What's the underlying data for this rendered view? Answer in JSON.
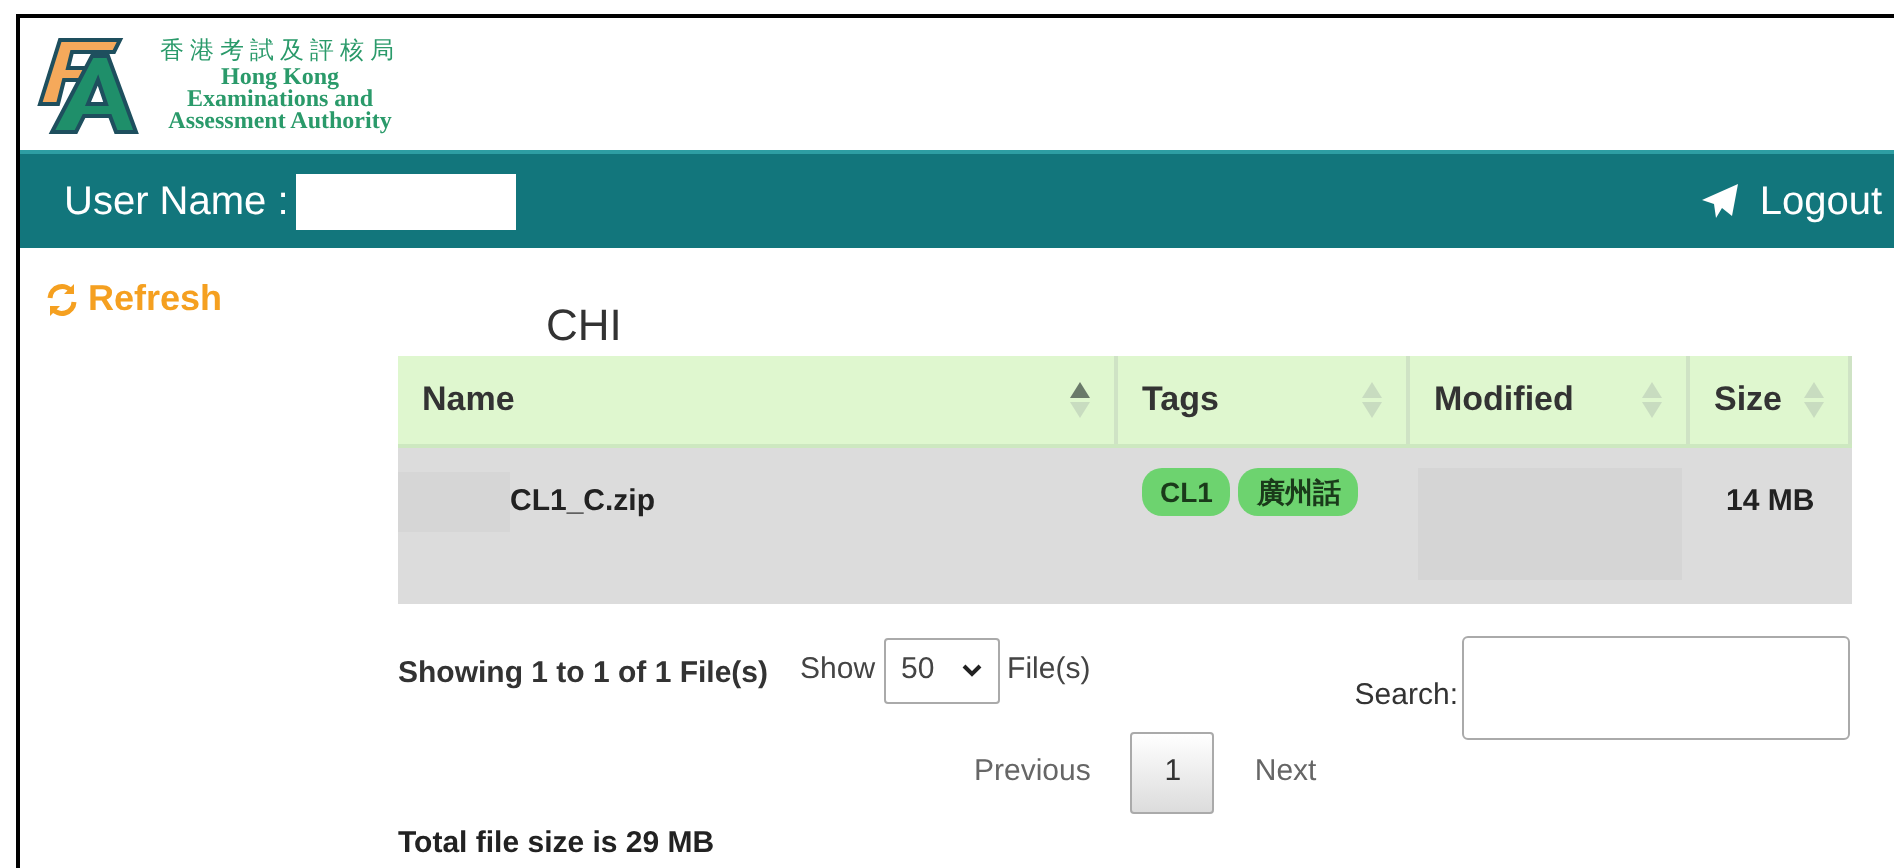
{
  "logo": {
    "chinese": "香港考試及評核局",
    "english_lines": [
      "Hong Kong",
      "Examinations and",
      "Assessment Authority"
    ]
  },
  "top_bar": {
    "user_label": "User Name :",
    "logout": "Logout"
  },
  "sidebar": {
    "refresh": "Refresh"
  },
  "folder_title": "CHI",
  "table": {
    "columns": [
      {
        "label": "Name",
        "sorted_ascending": true
      },
      {
        "label": "Tags",
        "sorted_ascending": false
      },
      {
        "label": "Modified",
        "sorted_ascending": false
      },
      {
        "label": "Size",
        "sorted_ascending": false
      }
    ],
    "rows": [
      {
        "name": "CL1_C.zip",
        "tags": [
          "CL1",
          "廣州話"
        ],
        "size": "14 MB",
        "selected": true
      }
    ]
  },
  "info": "Showing 1 to 1 of 1 File(s)",
  "length_menu": {
    "label": "Show",
    "value": "50",
    "suffix": "File(s)"
  },
  "search": {
    "label": "Search:"
  },
  "pagination": {
    "previous": "Previous",
    "pages": [
      {
        "label": "1",
        "selected": true
      }
    ],
    "next": "Next"
  },
  "total": "Total file size is 29 MB"
}
